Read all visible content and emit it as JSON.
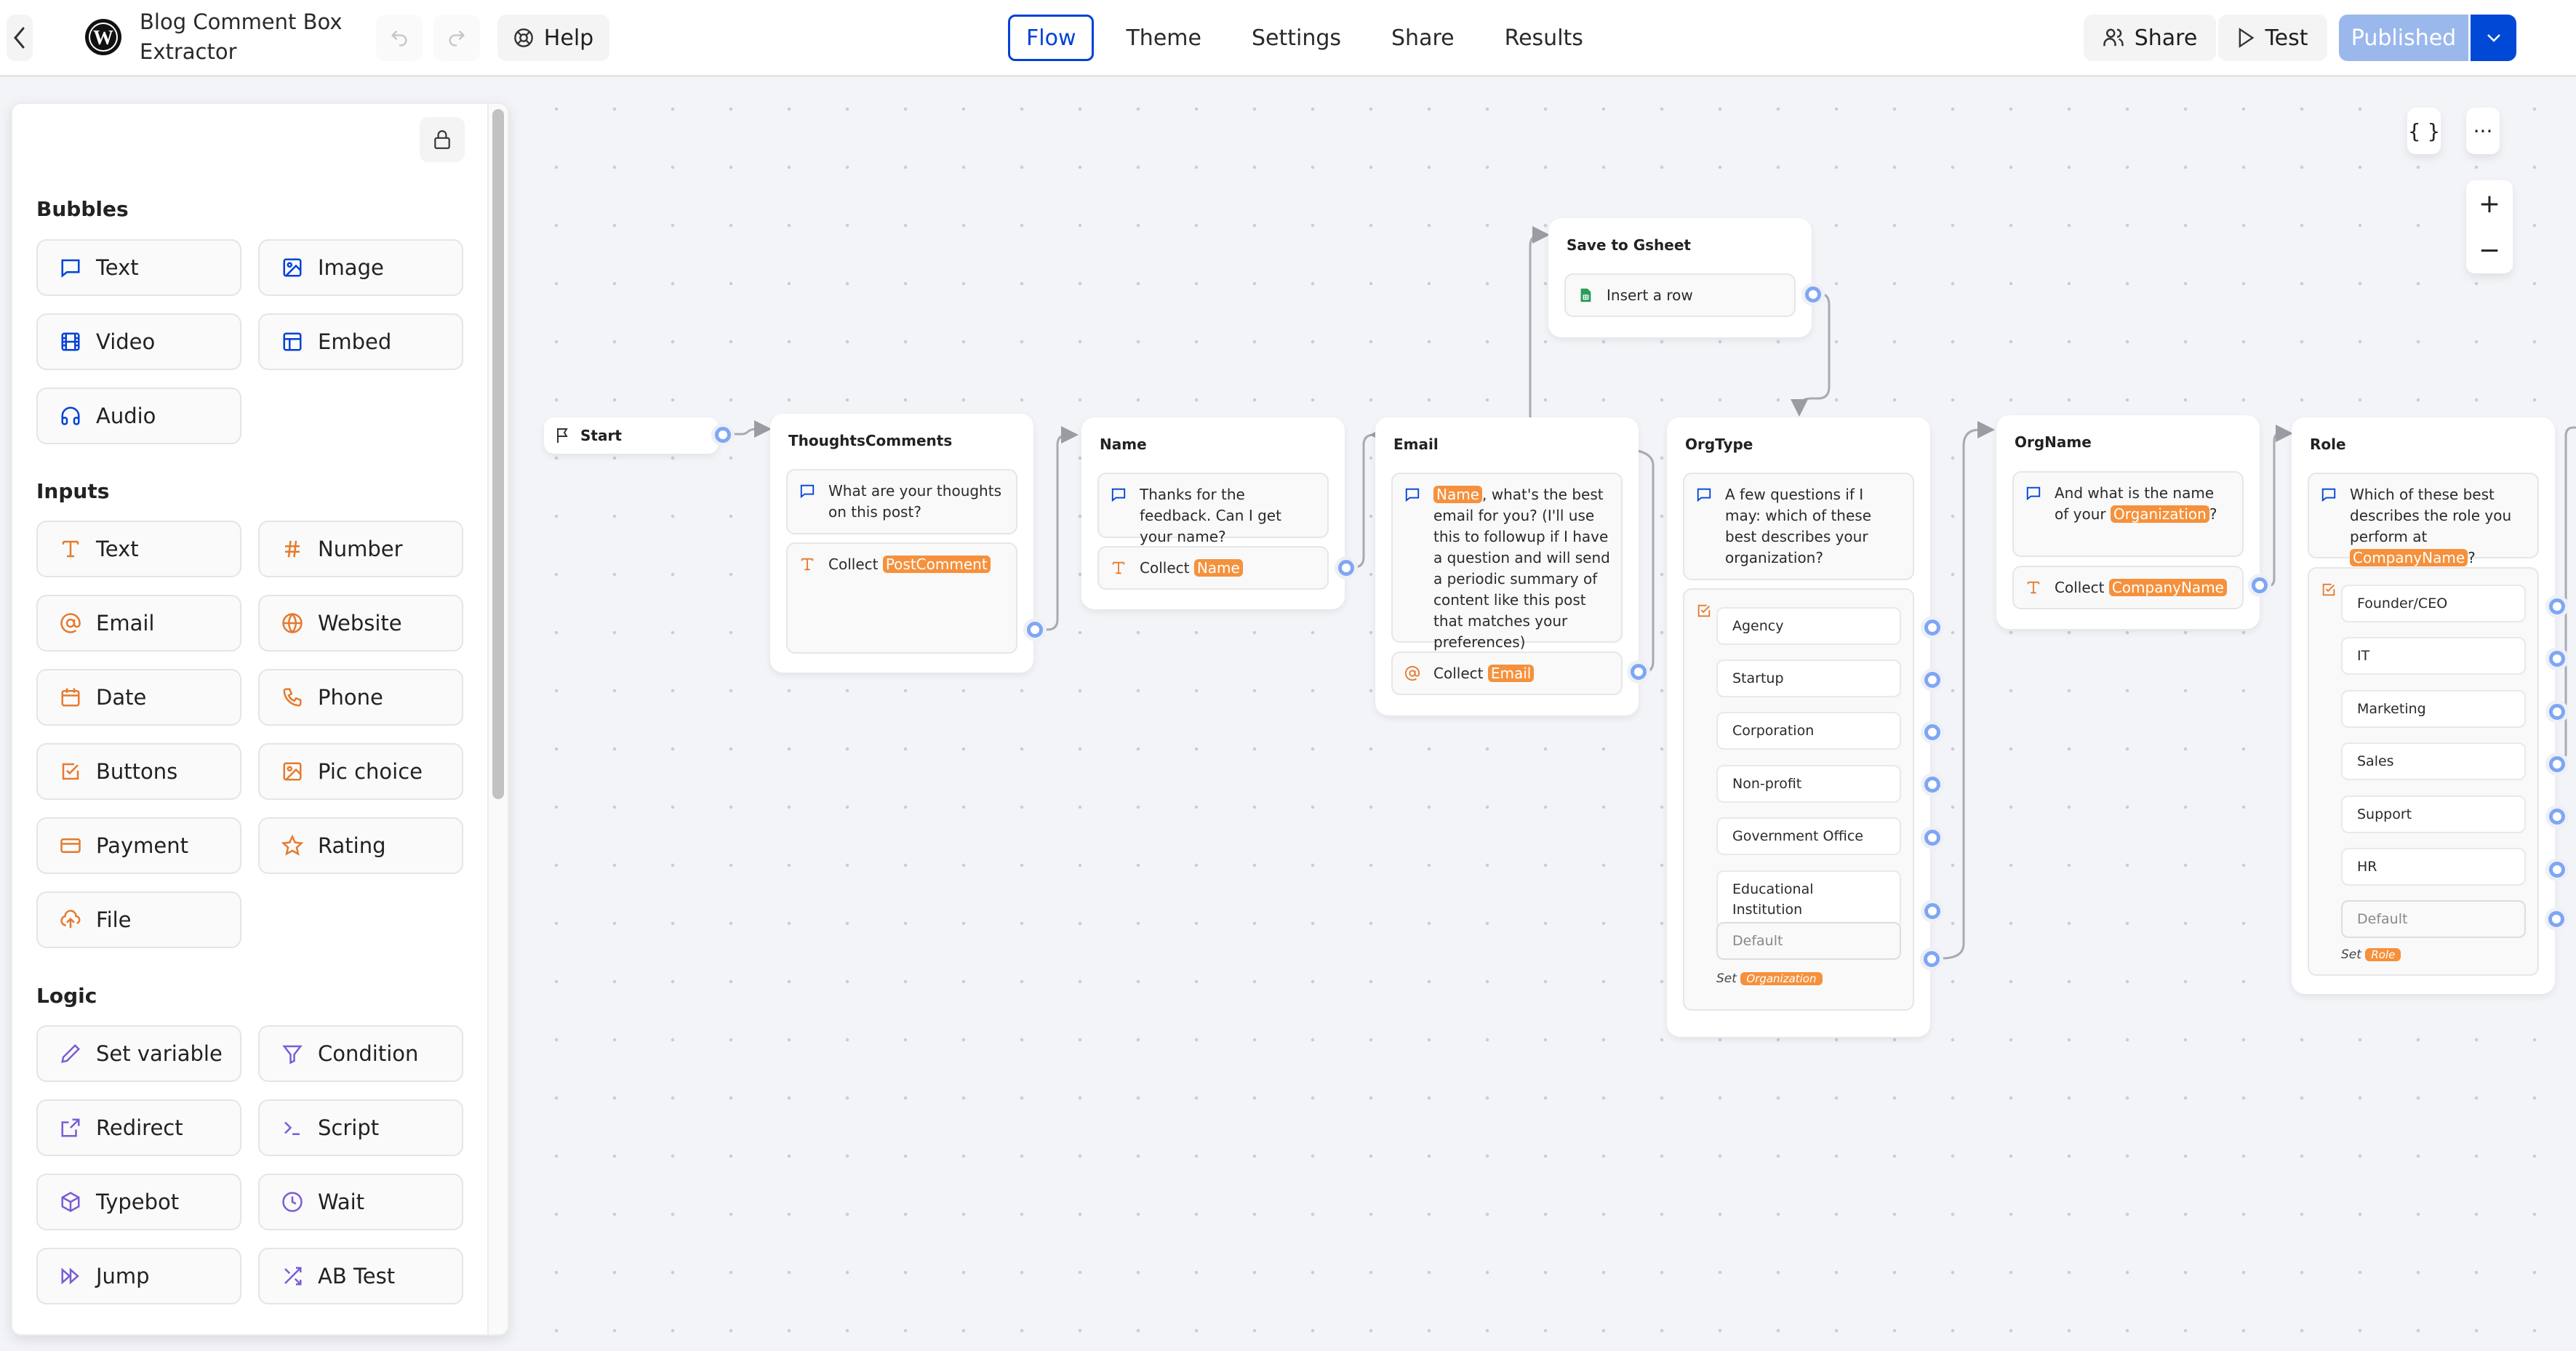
{
  "header": {
    "title": "Blog Comment Box Extractor",
    "help_label": "Help",
    "tabs": [
      {
        "label": "Flow",
        "active": true
      },
      {
        "label": "Theme",
        "active": false
      },
      {
        "label": "Settings",
        "active": false
      },
      {
        "label": "Share",
        "active": false
      },
      {
        "label": "Results",
        "active": false
      }
    ],
    "share_label": "Share",
    "test_label": "Test",
    "publish_label": "Published"
  },
  "sidebar": {
    "sections": [
      {
        "title": "Bubbles",
        "items": [
          "Text",
          "Image",
          "Video",
          "Embed",
          "Audio"
        ]
      },
      {
        "title": "Inputs",
        "items": [
          "Text",
          "Number",
          "Email",
          "Website",
          "Date",
          "Phone",
          "Buttons",
          "Pic choice",
          "Payment",
          "Rating",
          "File"
        ]
      },
      {
        "title": "Logic",
        "items": [
          "Set variable",
          "Condition",
          "Redirect",
          "Script",
          "Typebot",
          "Wait",
          "Jump",
          "AB Test"
        ]
      }
    ]
  },
  "canvas_controls": {
    "variables_label": "{ }",
    "more_label": "···",
    "zoom_in": "+",
    "zoom_out": "−"
  },
  "colors": {
    "accent": "#0042d6",
    "bubble_icon": "#0042d6",
    "input_icon": "#e57a2e",
    "logic_icon": "#7b5cd6",
    "variable_tag": "#f5913c",
    "port": "#7fa6f5"
  },
  "flow": {
    "start": {
      "label": "Start"
    },
    "nodes": {
      "thoughts": {
        "title": "ThoughtsComments",
        "bubble": "What are your thoughts on this post?",
        "collect_label": "Collect",
        "collect_var": "PostComment"
      },
      "name": {
        "title": "Name",
        "bubble": "Thanks for the feedback. Can I get your name?",
        "collect_label": "Collect",
        "collect_var": "Name"
      },
      "email": {
        "title": "Email",
        "bubble_var": "Name",
        "bubble_rest": ", what's the best email for you? (I'll use this to followup if I have a question and will send a periodic summary of content like this post that matches your preferences)",
        "collect_label": "Collect",
        "collect_var": "Email"
      },
      "gsheet": {
        "title": "Save to Gsheet",
        "action": "Insert a row"
      },
      "orgtype": {
        "title": "OrgType",
        "bubble": "A few questions if I may: which of these best describes your organization?",
        "choices": [
          "Agency",
          "Startup",
          "Corporation",
          "Non-profit",
          "Government Office",
          "Educational Institution"
        ],
        "default_label": "Default",
        "set_label": "Set",
        "set_var": "Organization"
      },
      "orgname": {
        "title": "OrgName",
        "bubble_pre": "And what is the name of your ",
        "bubble_var": "Organization",
        "bubble_post": "?",
        "collect_label": "Collect",
        "collect_var": "CompanyName"
      },
      "role": {
        "title": "Role",
        "bubble_pre": "Which of these best describes the role you perform at ",
        "bubble_var": "CompanyName",
        "bubble_post": "?",
        "choices": [
          "Founder/CEO",
          "IT",
          "Marketing",
          "Sales",
          "Support",
          "HR"
        ],
        "default_label": "Default",
        "set_label": "Set",
        "set_var": "Role"
      }
    }
  }
}
